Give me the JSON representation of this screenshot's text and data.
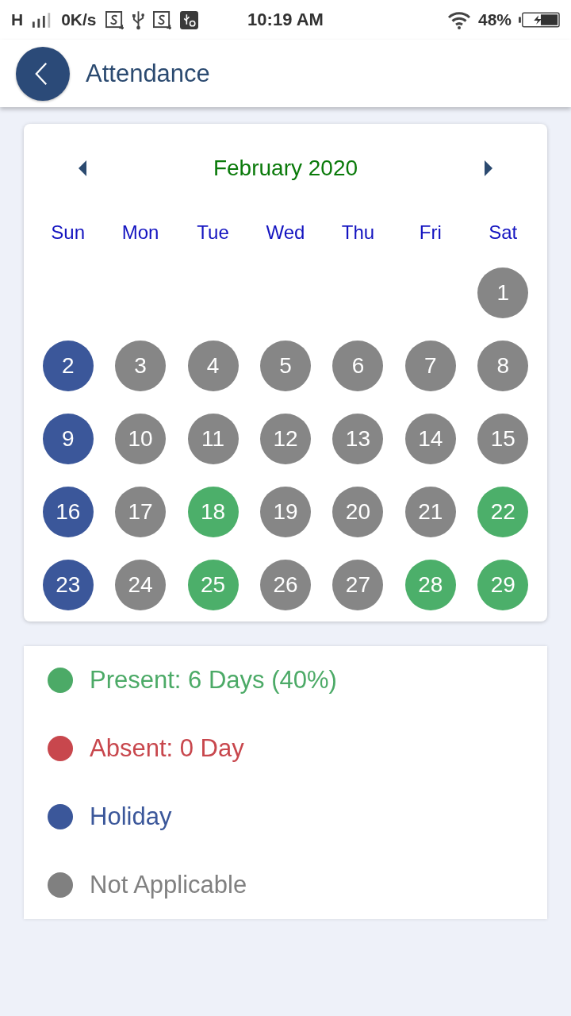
{
  "status_bar": {
    "network": "H",
    "speed": "0K/s",
    "time": "10:19 AM",
    "battery": "48%"
  },
  "header": {
    "title": "Attendance"
  },
  "calendar": {
    "month": "February 2020",
    "weekdays": [
      "Sun",
      "Mon",
      "Tue",
      "Wed",
      "Thu",
      "Fri",
      "Sat"
    ],
    "weeks": [
      {
        "days": [
          {
            "label": "1",
            "color": "#868686"
          }
        ]
      },
      {
        "days": [
          {
            "label": "2",
            "color": "#3b579a"
          },
          {
            "label": "3",
            "color": "#868686"
          },
          {
            "label": "4",
            "color": "#868686"
          },
          {
            "label": "5",
            "color": "#868686"
          },
          {
            "label": "6",
            "color": "#868686"
          },
          {
            "label": "7",
            "color": "#868686"
          },
          {
            "label": "8",
            "color": "#868686"
          }
        ]
      },
      {
        "days": [
          {
            "label": "9",
            "color": "#3b579a"
          },
          {
            "label": "10",
            "color": "#868686"
          },
          {
            "label": "11",
            "color": "#868686"
          },
          {
            "label": "12",
            "color": "#868686"
          },
          {
            "label": "13",
            "color": "#868686"
          },
          {
            "label": "14",
            "color": "#868686"
          },
          {
            "label": "15",
            "color": "#868686"
          }
        ]
      },
      {
        "days": [
          {
            "label": "16",
            "color": "#3b579a"
          },
          {
            "label": "17",
            "color": "#868686"
          },
          {
            "label": "18",
            "color": "#4caf6a"
          },
          {
            "label": "19",
            "color": "#868686"
          },
          {
            "label": "20",
            "color": "#868686"
          },
          {
            "label": "21",
            "color": "#868686"
          },
          {
            "label": "22",
            "color": "#4caf6a"
          }
        ]
      },
      {
        "days": [
          {
            "label": "23",
            "color": "#3b579a"
          },
          {
            "label": "24",
            "color": "#868686"
          },
          {
            "label": "25",
            "color": "#4caf6a"
          },
          {
            "label": "26",
            "color": "#868686"
          },
          {
            "label": "27",
            "color": "#868686"
          },
          {
            "label": "28",
            "color": "#4caf6a"
          },
          {
            "label": "29",
            "color": "#4caf6a"
          }
        ]
      }
    ]
  },
  "legend": [
    {
      "label": "Present: 6 Days (40%)",
      "color": "#4caa67"
    },
    {
      "label": "Absent: 0 Day",
      "color": "#c8474d"
    },
    {
      "label": "Holiday",
      "color": "#3b579a"
    },
    {
      "label": "Not Applicable",
      "color": "#808080"
    }
  ]
}
